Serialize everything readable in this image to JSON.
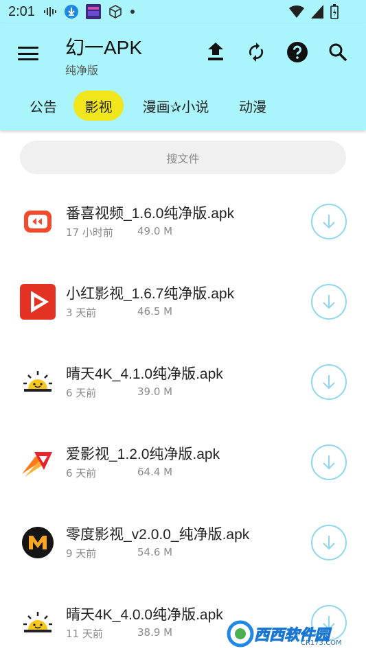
{
  "status_bar": {
    "time": "2:01",
    "icons": [
      "audio-wave-icon",
      "download-notification-icon",
      "app-thumbnail-icon",
      "cube-icon",
      "dot-icon"
    ],
    "right_icons": [
      "wifi-icon",
      "signal-icon",
      "battery-icon"
    ]
  },
  "app_bar": {
    "title": "幻一APK",
    "subtitle": "纯净版",
    "actions": [
      "upload-icon",
      "refresh-icon",
      "help-icon",
      "search-icon"
    ]
  },
  "tabs": [
    {
      "label": "公告",
      "active": false
    },
    {
      "label": "影视",
      "active": true
    },
    {
      "label": "漫画✰小说",
      "active": false
    },
    {
      "label": "动漫",
      "active": false
    }
  ],
  "search": {
    "placeholder": "搜文件"
  },
  "files": [
    {
      "name": "番喜视频_1.6.0纯净版.apk",
      "time": "17 小时前",
      "size": "49.0 M",
      "icon": "fanxi-app-icon"
    },
    {
      "name": "小红影视_1.6.7纯净版.apk",
      "time": "3 天前",
      "size": "46.5 M",
      "icon": "xiaohong-app-icon"
    },
    {
      "name": "晴天4K_4.1.0纯净版.apk",
      "time": "6 天前",
      "size": "39.0 M",
      "icon": "qingtian-app-icon"
    },
    {
      "name": "爱影视_1.2.0纯净版.apk",
      "time": "6 天前",
      "size": "64.4 M",
      "icon": "aiyingshi-app-icon"
    },
    {
      "name": "零度影视_v2.0.0_纯净版.apk",
      "time": "9 天前",
      "size": "54.6 M",
      "icon": "lingdu-app-icon"
    },
    {
      "name": "晴天4K_4.0.0纯净版.apk",
      "time": "11 天前",
      "size": "38.9 M",
      "icon": "qingtian-app-icon"
    }
  ],
  "watermark": {
    "text": "西西软件园",
    "sub": "CR173.COM"
  },
  "colors": {
    "app_bar": "#a9f5fb",
    "active_tab": "#f1e51c",
    "download_ring": "#8fd6ee"
  }
}
